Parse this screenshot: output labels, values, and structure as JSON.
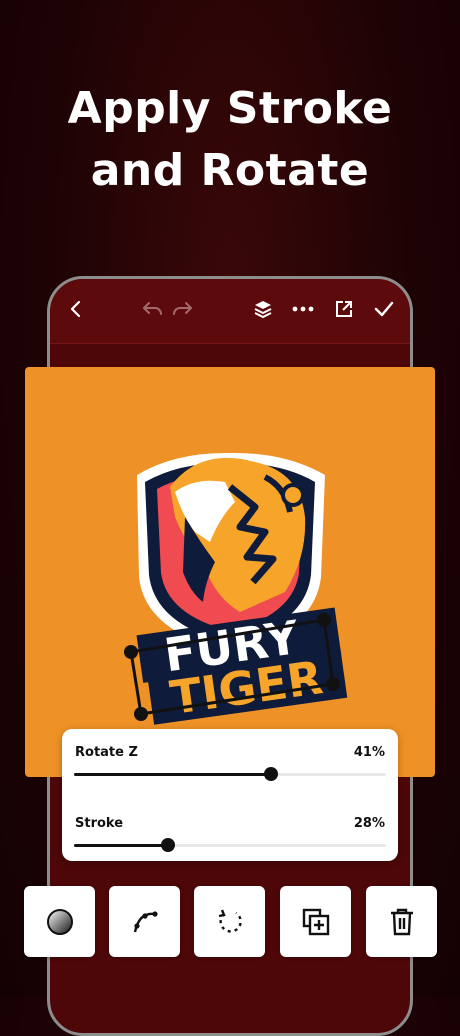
{
  "headline": {
    "line1": "Apply Stroke",
    "line2": "and Rotate"
  },
  "toolbar": {
    "icons": [
      "back-icon",
      "undo-icon",
      "redo-icon",
      "layers-icon",
      "more-icon",
      "export-icon",
      "check-icon"
    ]
  },
  "logo": {
    "word1": "FURY",
    "word2": "TIGER"
  },
  "adjust": {
    "rotate": {
      "label": "Rotate Z",
      "value_text": "41%",
      "value": 0.63
    },
    "stroke": {
      "label": "Stroke",
      "value_text": "28%",
      "value": 0.3
    }
  },
  "tools": [
    "color-tool",
    "curve-tool",
    "rotate-tool",
    "duplicate-tool",
    "delete-tool"
  ],
  "colors": {
    "background": "#1e0305",
    "canvas": "#ee9126",
    "toolbar": "#5d0a0c",
    "accent": "#111111"
  }
}
